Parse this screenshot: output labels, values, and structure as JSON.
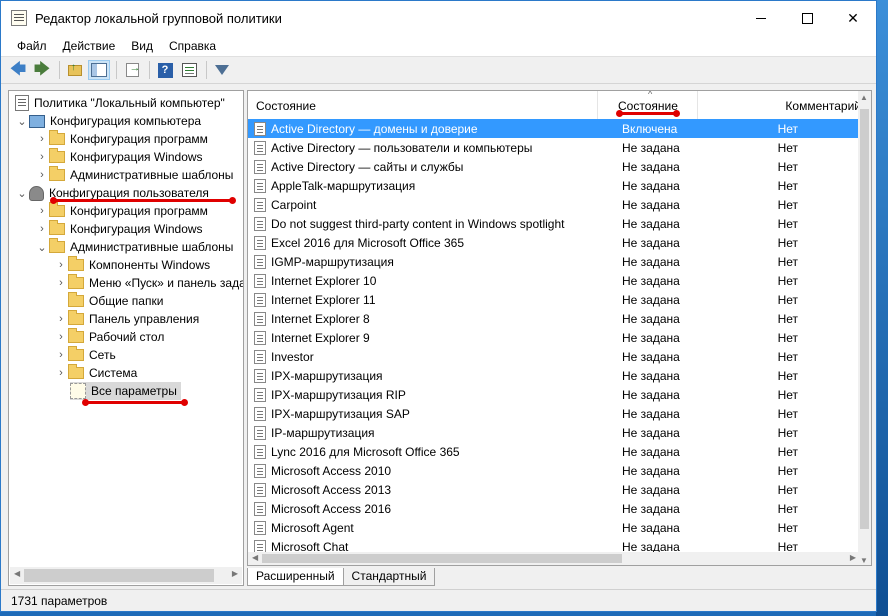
{
  "window": {
    "title": "Редактор локальной групповой политики",
    "close_label": "✕"
  },
  "menu": [
    "Файл",
    "Действие",
    "Вид",
    "Справка"
  ],
  "toolbar": {
    "icons": [
      "back-arrow-icon",
      "forward-arrow-icon",
      "folder-up-icon",
      "show-hide-pane-icon",
      "export-list-icon",
      "help-icon",
      "properties-icon",
      "filter-icon"
    ],
    "back": "🡄",
    "forward": "🡆"
  },
  "tree": {
    "root": "Политика \"Локальный компьютер\"",
    "computer_config": "Конфигурация компьютера",
    "cc_programs": "Конфигурация программ",
    "cc_windows": "Конфигурация Windows",
    "cc_admin": "Административные шаблоны",
    "user_config": "Конфигурация пользователя",
    "uc_programs": "Конфигурация программ",
    "uc_windows": "Конфигурация Windows",
    "uc_admin": "Административные шаблоны",
    "windows_components": "Компоненты Windows",
    "start_menu": "Меню «Пуск» и панель задач",
    "shared_folders": "Общие папки",
    "control_panel": "Панель управления",
    "desktop": "Рабочий стол",
    "network": "Сеть",
    "system": "Система",
    "all_settings": "Все параметры"
  },
  "list": {
    "columns": {
      "name": "Состояние",
      "state": "Состояние",
      "comment": "Комментарий"
    },
    "sort_caret": "^",
    "rows": [
      {
        "name": "Active Directory — домены и доверие",
        "state": "Включена",
        "comment": "Нет"
      },
      {
        "name": "Active Directory — пользователи и компьютеры",
        "state": "Не задана",
        "comment": "Нет"
      },
      {
        "name": "Active Directory — сайты и службы",
        "state": "Не задана",
        "comment": "Нет"
      },
      {
        "name": "AppleTalk-маршрутизация",
        "state": "Не задана",
        "comment": "Нет"
      },
      {
        "name": "Carpoint",
        "state": "Не задана",
        "comment": "Нет"
      },
      {
        "name": "Do not suggest third-party content in Windows spotlight",
        "state": "Не задана",
        "comment": "Нет"
      },
      {
        "name": "Excel 2016 для Microsoft Office 365",
        "state": "Не задана",
        "comment": "Нет"
      },
      {
        "name": "IGMP-маршрутизация",
        "state": "Не задана",
        "comment": "Нет"
      },
      {
        "name": "Internet Explorer 10",
        "state": "Не задана",
        "comment": "Нет"
      },
      {
        "name": "Internet Explorer 11",
        "state": "Не задана",
        "comment": "Нет"
      },
      {
        "name": "Internet Explorer 8",
        "state": "Не задана",
        "comment": "Нет"
      },
      {
        "name": "Internet Explorer 9",
        "state": "Не задана",
        "comment": "Нет"
      },
      {
        "name": "Investor",
        "state": "Не задана",
        "comment": "Нет"
      },
      {
        "name": "IPX-маршрутизация",
        "state": "Не задана",
        "comment": "Нет"
      },
      {
        "name": "IPX-маршрутизация RIP",
        "state": "Не задана",
        "comment": "Нет"
      },
      {
        "name": "IPX-маршрутизация SAP",
        "state": "Не задана",
        "comment": "Нет"
      },
      {
        "name": "IP-маршрутизация",
        "state": "Не задана",
        "comment": "Нет"
      },
      {
        "name": "Lync 2016 для Microsoft Office 365",
        "state": "Не задана",
        "comment": "Нет"
      },
      {
        "name": "Microsoft Access 2010",
        "state": "Не задана",
        "comment": "Нет"
      },
      {
        "name": "Microsoft Access 2013",
        "state": "Не задана",
        "comment": "Нет"
      },
      {
        "name": "Microsoft Access 2016",
        "state": "Не задана",
        "comment": "Нет"
      },
      {
        "name": "Microsoft Agent",
        "state": "Не задана",
        "comment": "Нет"
      },
      {
        "name": "Microsoft Chat",
        "state": "Не задана",
        "comment": "Нет"
      }
    ]
  },
  "tabs": [
    "Расширенный",
    "Стандартный"
  ],
  "status": "1731 параметров",
  "accent": {
    "selection": "#3399ff",
    "annotation": "#e00000"
  }
}
